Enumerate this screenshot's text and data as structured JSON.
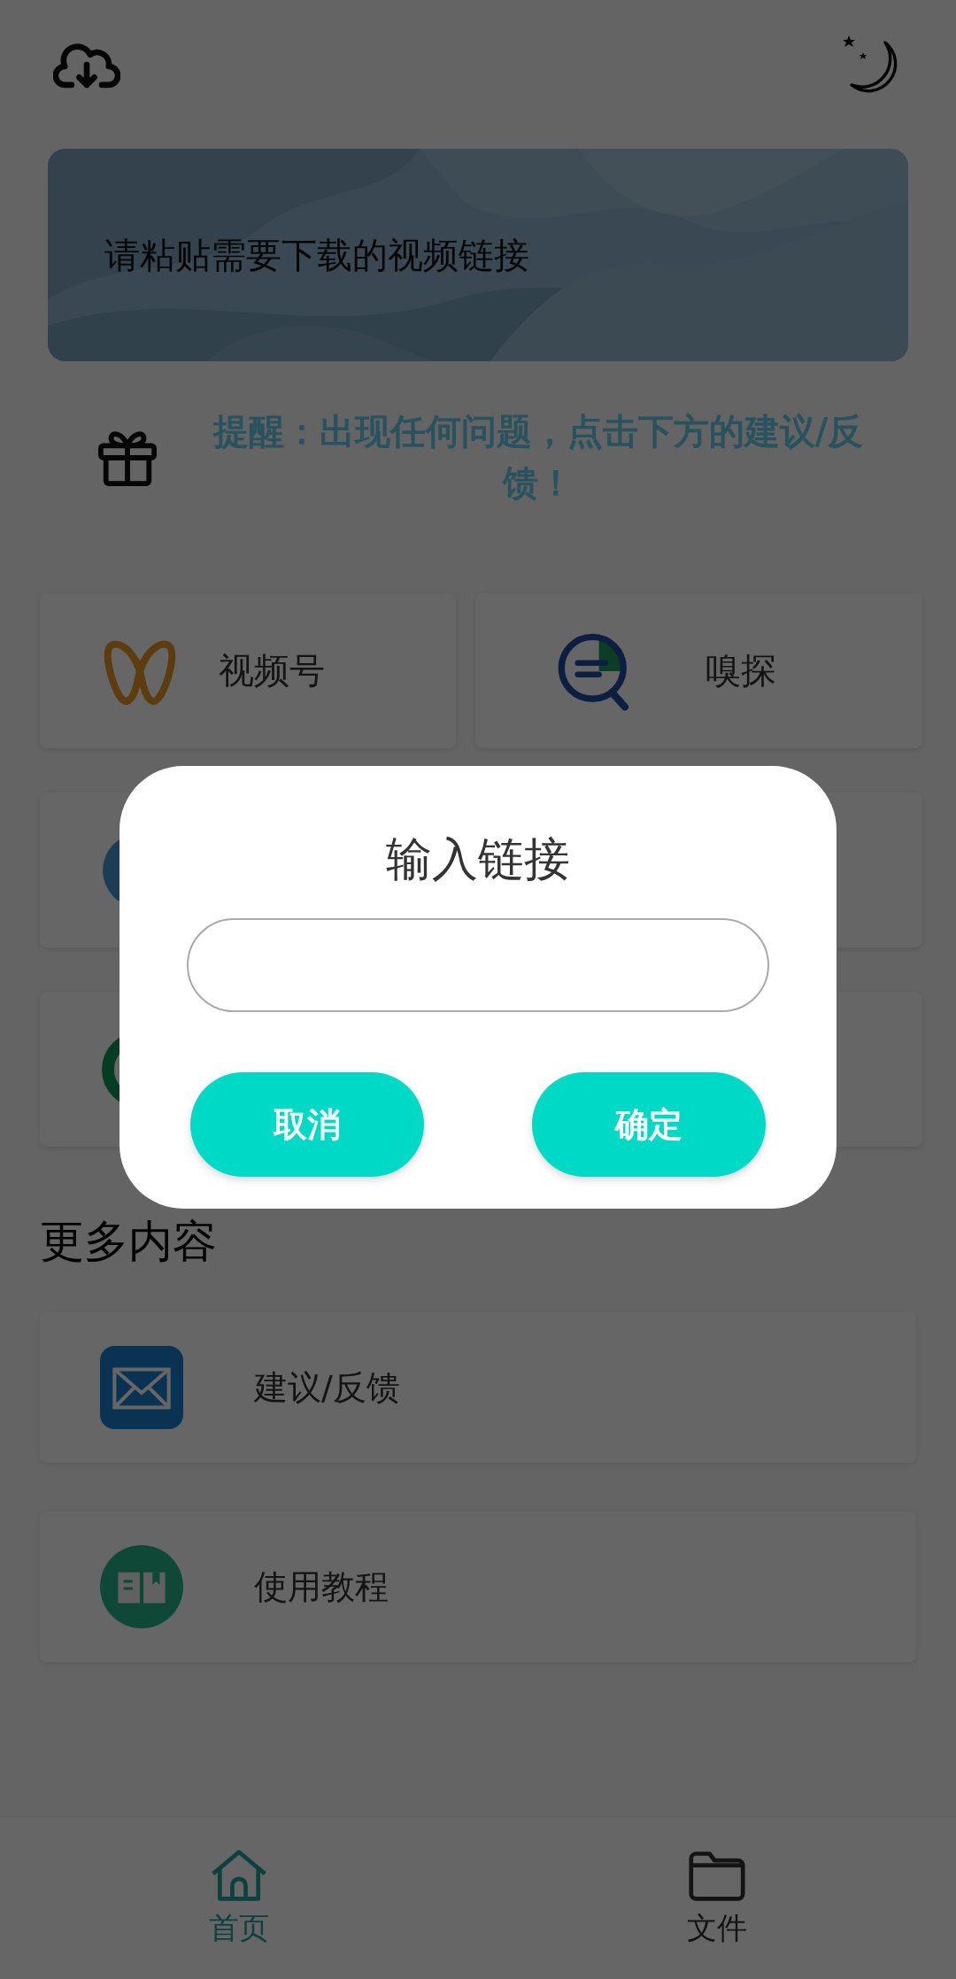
{
  "link_field": {
    "placeholder": "请粘贴需要下载的视频链接"
  },
  "notice": {
    "text": "提醒：出现任何问题，点击下方的建议/反馈！"
  },
  "features": [
    {
      "kind": "loop",
      "label": "视频号"
    },
    {
      "kind": "sniff",
      "label": "嗅探"
    },
    {
      "kind": "globe"
    },
    {
      "kind": "blank"
    },
    {
      "kind": "ring"
    },
    {
      "kind": "blank"
    }
  ],
  "more": {
    "title": "更多内容",
    "items": [
      {
        "kind": "mail",
        "label": "建议/反馈"
      },
      {
        "kind": "book",
        "label": "使用教程"
      }
    ]
  },
  "dialog": {
    "title": "输入链接",
    "buttons": [
      {
        "label": "取消"
      },
      {
        "label": "确定"
      }
    ]
  },
  "tabs": [
    {
      "kind": "home",
      "label": "首页",
      "selected": true
    },
    {
      "kind": "folder",
      "label": "文件",
      "selected": false
    }
  ]
}
